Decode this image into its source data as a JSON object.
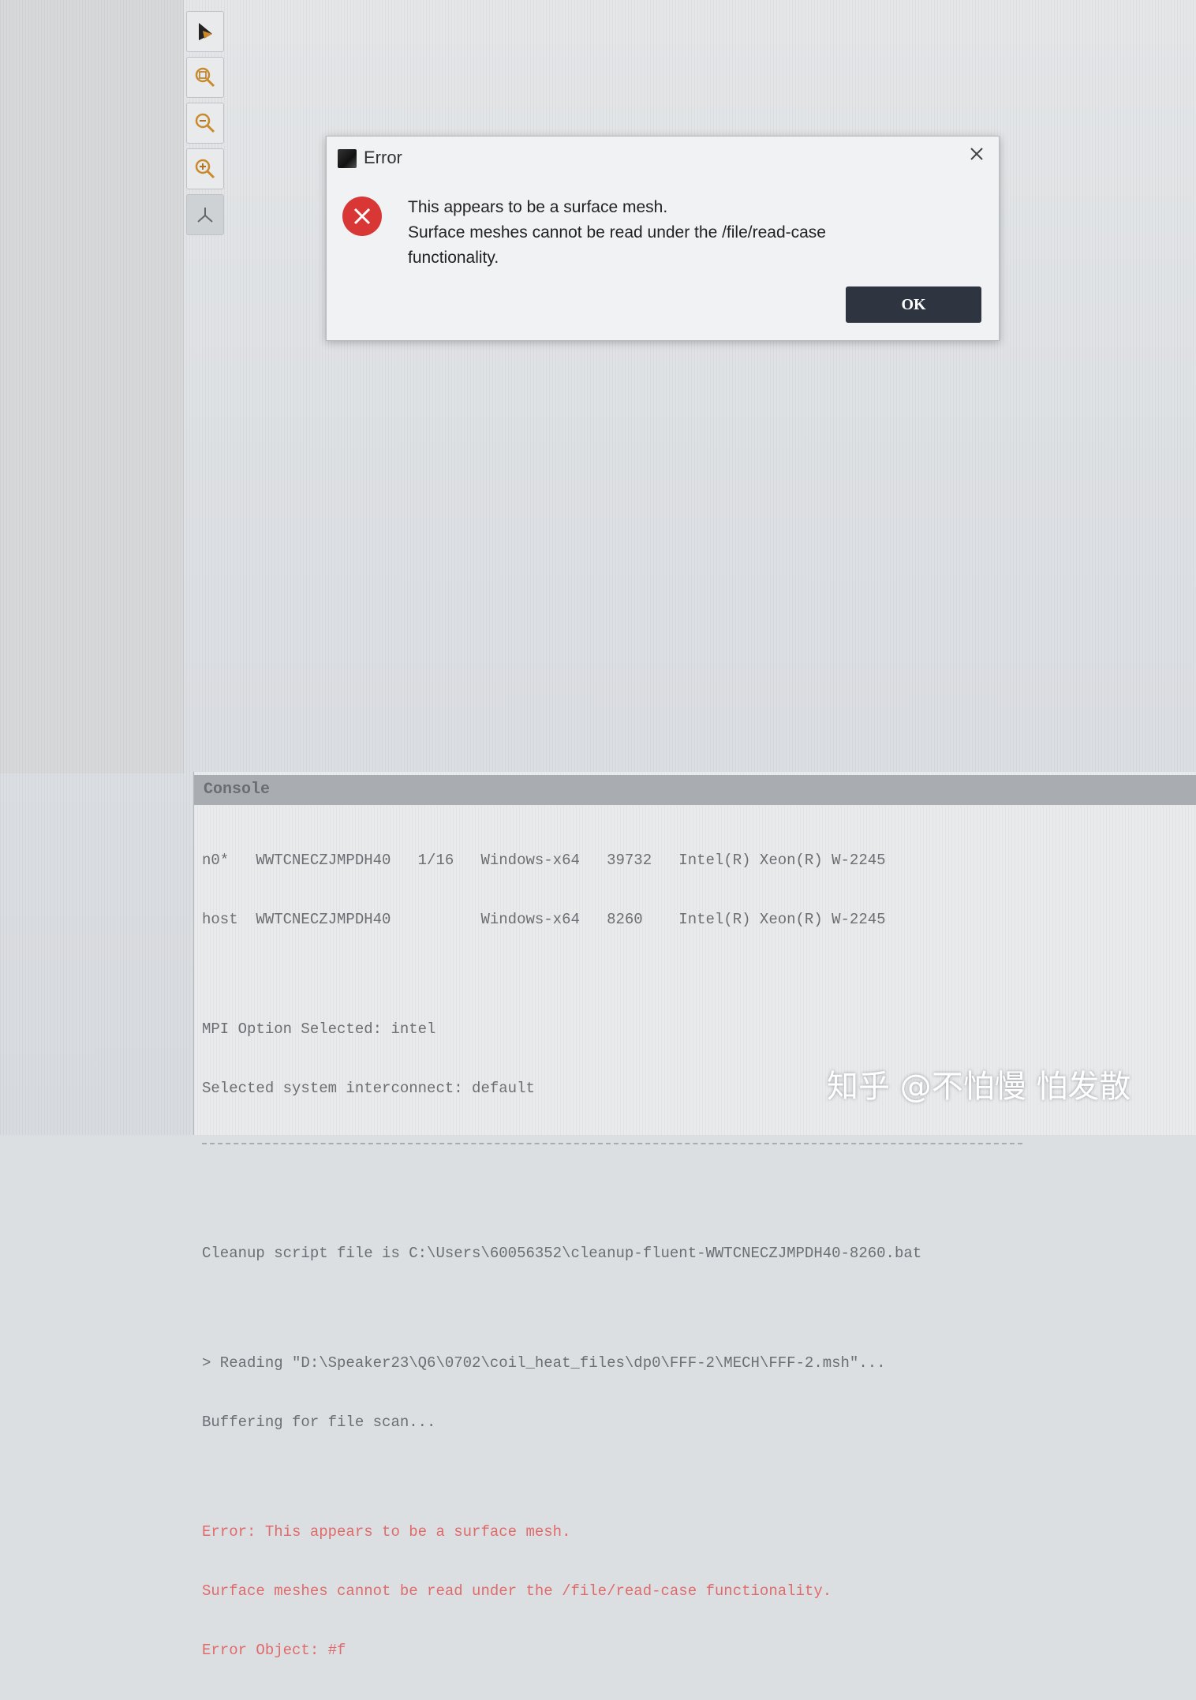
{
  "dialog": {
    "title": "Error",
    "message_lines": [
      "This appears to be a surface mesh.",
      "Surface meshes cannot be read under the /file/read-case",
      "functionality."
    ],
    "ok_label": "OK"
  },
  "toolbar": {
    "icons": [
      "cursor-icon",
      "zoom-fit-icon",
      "zoom-out-icon",
      "zoom-in-icon",
      "axes-icon"
    ]
  },
  "console": {
    "header": "Console",
    "lines": [
      "n0*   WWTCNECZJMPDH40   1/16   Windows-x64   39732   Intel(R) Xeon(R) W-2245",
      "host  WWTCNECZJMPDH40          Windows-x64   8260    Intel(R) Xeon(R) W-2245",
      "MPI Option Selected: intel",
      "Selected system interconnect: default",
      "Cleanup script file is C:\\Users\\60056352\\cleanup-fluent-WWTCNECZJMPDH40-8260.bat",
      "> Reading \"D:\\Speaker23\\Q6\\0702\\coil_heat_files\\dp0\\FFF-2\\MECH\\FFF-2.msh\"...",
      "Buffering for file scan...",
      "Error: This appears to be a surface mesh.",
      "Surface meshes cannot be read under the /file/read-case functionality.",
      "Error Object: #f"
    ]
  },
  "watermark": "知乎 @不怕慢 怕发散",
  "colors": {
    "ok_button": "#2e3540",
    "error_icon": "#d93636",
    "console_error_text": "#e06a6a"
  }
}
